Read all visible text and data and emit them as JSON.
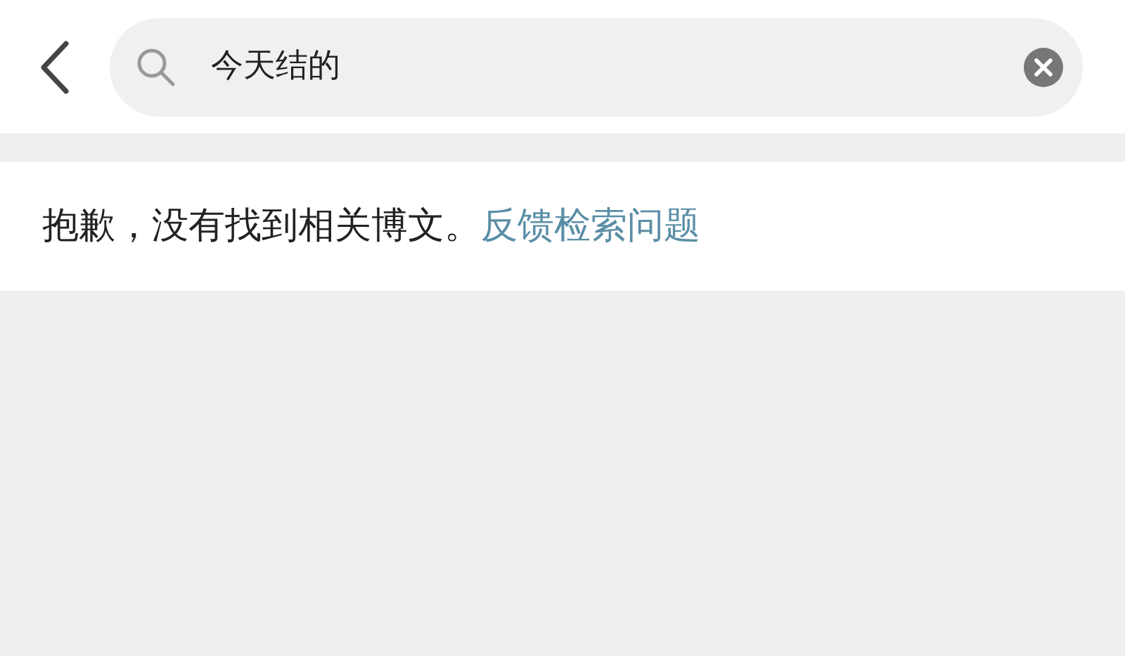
{
  "search": {
    "value": "今天结的"
  },
  "result": {
    "message": "抱歉，没有找到相关博文。",
    "link": "反馈检索问题"
  }
}
